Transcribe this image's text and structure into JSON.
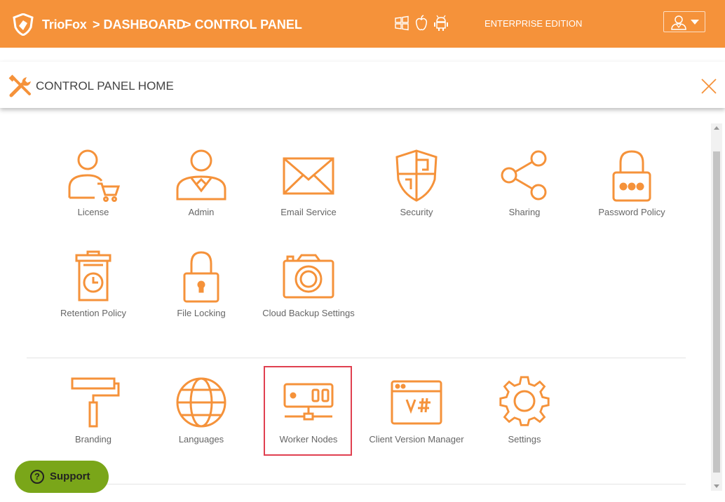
{
  "header": {
    "brand": "TrioFox",
    "crumb_dashboard": "> DASHBOARD",
    "crumb_control_panel": "> CONTROL PANEL",
    "edition": "ENTERPRISE EDITION",
    "os_icons": [
      "windows-icon",
      "apple-icon",
      "android-icon"
    ],
    "accent": "#f5923a"
  },
  "panel": {
    "title": "CONTROL PANEL HOME"
  },
  "tiles_row1": [
    {
      "label": "License",
      "icon": "license-user-cart-icon"
    },
    {
      "label": "Admin",
      "icon": "admin-user-icon"
    },
    {
      "label": "Email Service",
      "icon": "envelope-icon"
    },
    {
      "label": "Security",
      "icon": "shield-icon"
    },
    {
      "label": "Sharing",
      "icon": "share-icon"
    },
    {
      "label": "Password Policy",
      "icon": "padlock-dots-icon"
    }
  ],
  "tiles_row2": [
    {
      "label": "Retention Policy",
      "icon": "trash-clock-icon"
    },
    {
      "label": "File Locking",
      "icon": "padlock-icon"
    },
    {
      "label": "Cloud Backup Settings",
      "icon": "camera-icon"
    }
  ],
  "tiles_row3": [
    {
      "label": "Branding",
      "icon": "paint-roller-icon"
    },
    {
      "label": "Languages",
      "icon": "globe-icon"
    },
    {
      "label": "Worker Nodes",
      "icon": "server-icon"
    },
    {
      "label": "Client Version Manager",
      "icon": "browser-code-icon"
    },
    {
      "label": "Settings",
      "icon": "gear-icon"
    }
  ],
  "support": {
    "label": "Support"
  },
  "highlight_color": "#e04050"
}
